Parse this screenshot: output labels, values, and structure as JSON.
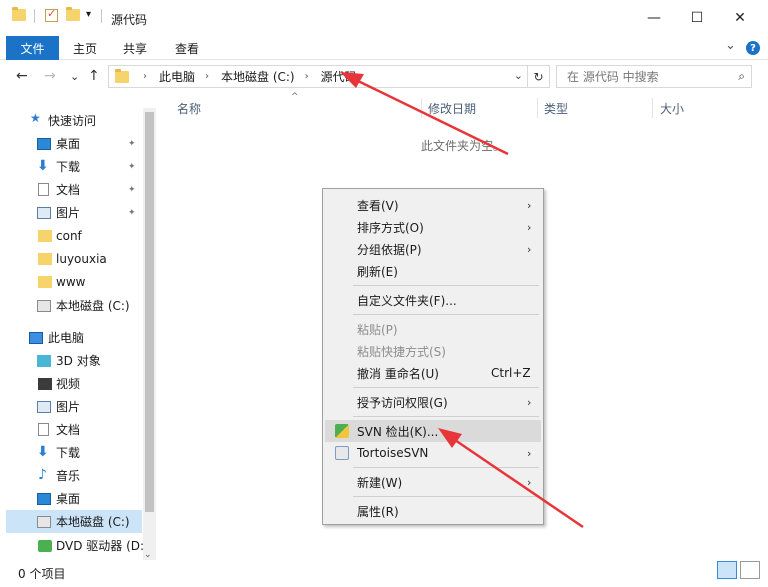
{
  "window": {
    "title": "源代码",
    "minimize": "—",
    "maximize": "☐",
    "close": "✕"
  },
  "ribbon": {
    "tabs": [
      "文件",
      "主页",
      "共享",
      "查看"
    ],
    "collapse": "⌄",
    "help": "?"
  },
  "address": {
    "back": "←",
    "forward": "→",
    "recent": "⌄",
    "up": "↑",
    "crumbs": [
      "此电脑",
      "本地磁盘 (C:)",
      "源代码"
    ],
    "crumb_sep": "›",
    "dropdown": "⌄",
    "refresh": "↻",
    "search_placeholder": "在 源代码 中搜索",
    "search_icon": "⌕"
  },
  "nav": {
    "quick_access": "快速访问",
    "items": [
      {
        "label": "桌面",
        "icon": "desktop-icon",
        "pinned": true
      },
      {
        "label": "下载",
        "icon": "download-icon",
        "pinned": true
      },
      {
        "label": "文档",
        "icon": "document-icon",
        "pinned": true
      },
      {
        "label": "图片",
        "icon": "picture-icon",
        "pinned": true
      },
      {
        "label": "conf",
        "icon": "folder-icon",
        "pinned": false
      },
      {
        "label": "luyouxia",
        "icon": "folder-icon",
        "pinned": false
      },
      {
        "label": "www",
        "icon": "folder-icon",
        "pinned": false
      },
      {
        "label": "本地磁盘 (C:)",
        "icon": "disk-icon",
        "pinned": false
      }
    ],
    "this_pc": "此电脑",
    "pc_items": [
      {
        "label": "3D 对象",
        "icon": "3d-objects-icon"
      },
      {
        "label": "视频",
        "icon": "video-icon"
      },
      {
        "label": "图片",
        "icon": "picture-icon"
      },
      {
        "label": "文档",
        "icon": "document-icon"
      },
      {
        "label": "下载",
        "icon": "download-icon"
      },
      {
        "label": "音乐",
        "icon": "music-icon"
      },
      {
        "label": "桌面",
        "icon": "desktop-icon"
      },
      {
        "label": "本地磁盘 (C:)",
        "icon": "disk-icon",
        "selected": true
      },
      {
        "label": "DVD 驱动器 (D:",
        "icon": "dvd-icon"
      }
    ],
    "pin_glyph": "📌"
  },
  "columns": [
    "名称",
    "修改日期",
    "类型",
    "大小"
  ],
  "sort_indicator": "^",
  "empty_message": "此文件夹为空。",
  "context_menu": {
    "items": [
      {
        "label": "查看(V)",
        "submenu": true
      },
      {
        "label": "排序方式(O)",
        "submenu": true
      },
      {
        "label": "分组依据(P)",
        "submenu": true
      },
      {
        "label": "刷新(E)"
      },
      {
        "label": "自定义文件夹(F)..."
      },
      {
        "label": "粘贴(P)",
        "disabled": true
      },
      {
        "label": "粘贴快捷方式(S)",
        "disabled": true
      },
      {
        "label": "撤消 重命名(U)",
        "shortcut": "Ctrl+Z"
      },
      {
        "label": "授予访问权限(G)",
        "submenu": true
      },
      {
        "label": "SVN 检出(K)...",
        "icon": "svn-checkout-icon",
        "highlighted": true
      },
      {
        "label": "TortoiseSVN",
        "icon": "tortoisesvn-icon",
        "submenu": true
      },
      {
        "label": "新建(W)",
        "submenu": true
      },
      {
        "label": "属性(R)"
      }
    ],
    "submenu_arrow": "›"
  },
  "status": {
    "item_count": "0 个项目"
  },
  "colors": {
    "accent": "#1a73c7",
    "annotation_arrow": "#e8353a",
    "selection": "#cce4f7"
  }
}
